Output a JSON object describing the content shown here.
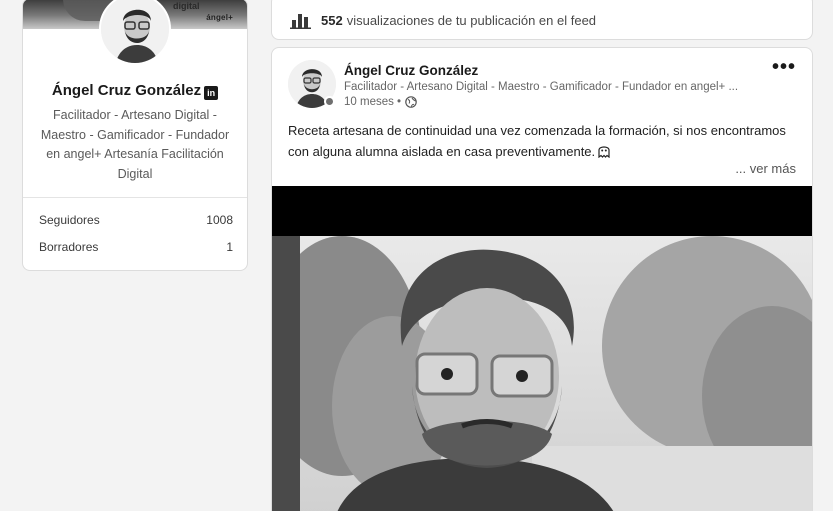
{
  "profile": {
    "cover_text": "digital",
    "cover_brand": "ángel+",
    "name": "Ángel Cruz González",
    "linkedin_badge": "in",
    "headline": "Facilitador - Artesano Digital - Maestro - Gamificador - Fundador en angel+ Artesanía Facilitación Digital",
    "stats": [
      {
        "label": "Seguidores",
        "value": "1008"
      },
      {
        "label": "Borradores",
        "value": "1"
      }
    ]
  },
  "views": {
    "count": "552",
    "text": "visualizaciones de tu publicación en el feed",
    "icon": "bar-chart-icon"
  },
  "post": {
    "author": "Ángel Cruz González",
    "headline": "Facilitador - Artesano Digital - Maestro - Gamificador - Fundador en angel+ ...",
    "time": "10 meses •",
    "visibility_icon": "globe-icon",
    "more_label": "•••",
    "text": "Receta artesana de continuidad una vez comenzada la formación, si nos encontramos con alguna alumna aislada en casa preventivamente.",
    "see_more": "... ver más"
  },
  "colors": {
    "background": "#f3f3f3",
    "card": "#ffffff",
    "border": "#dcdcdc",
    "text": "#1a1a1a",
    "muted": "#666666"
  }
}
